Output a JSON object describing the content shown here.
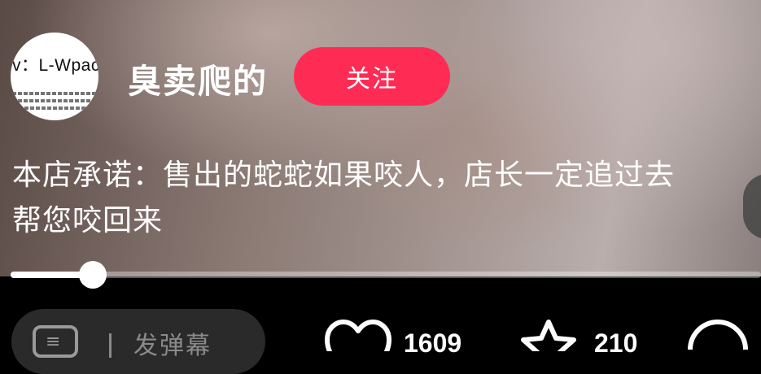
{
  "author": {
    "avatar_text": "v：L-Wpac",
    "username": "臭卖爬的",
    "follow_label": "关注"
  },
  "caption": "本店承诺：售出的蛇蛇如果咬人，店长一定追过去帮您咬回来",
  "playback": {
    "progress": 0.11
  },
  "bottom": {
    "comment_placeholder": "发弹幕",
    "like_count": "1609",
    "fav_count": "210"
  },
  "colors": {
    "accent": "#fe2c55"
  },
  "icons": [
    "danmaku-icon",
    "heart-icon",
    "star-icon",
    "comment-icon"
  ]
}
